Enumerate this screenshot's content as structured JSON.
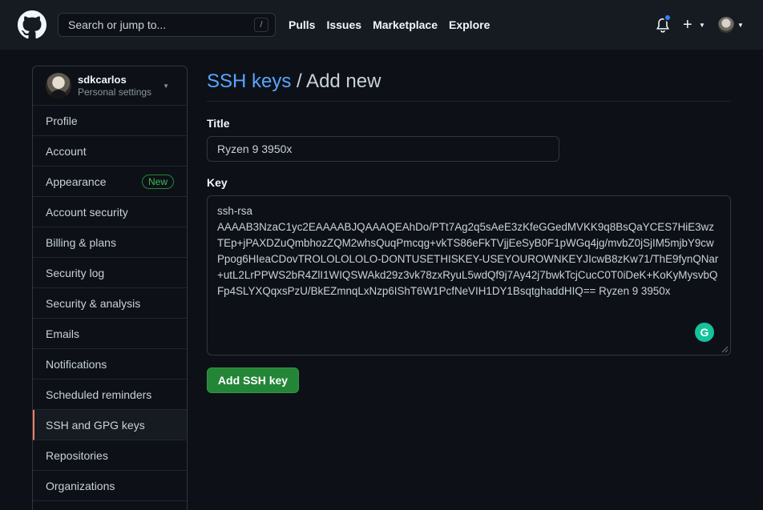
{
  "header": {
    "search_placeholder": "Search or jump to...",
    "search_shortcut": "/",
    "nav": [
      "Pulls",
      "Issues",
      "Marketplace",
      "Explore"
    ],
    "plus_symbol": "+"
  },
  "sidebar": {
    "username": "sdkcarlos",
    "subtitle": "Personal settings",
    "items": [
      {
        "label": "Profile"
      },
      {
        "label": "Account"
      },
      {
        "label": "Appearance",
        "badge": "New"
      },
      {
        "label": "Account security"
      },
      {
        "label": "Billing & plans"
      },
      {
        "label": "Security log"
      },
      {
        "label": "Security & analysis"
      },
      {
        "label": "Emails"
      },
      {
        "label": "Notifications"
      },
      {
        "label": "Scheduled reminders"
      },
      {
        "label": "SSH and GPG keys",
        "active": true
      },
      {
        "label": "Repositories"
      },
      {
        "label": "Organizations"
      }
    ]
  },
  "main": {
    "breadcrumb_link": "SSH keys",
    "breadcrumb_rest": " / Add new",
    "title_label": "Title",
    "title_value": "Ryzen 9 3950x",
    "key_label": "Key",
    "key_value": "ssh-rsa\nAAAAB3NzaC1yc2EAAAABJQAAAQEAhDo/PTt7Ag2q5sAeE3zKfeGGedMVKK9q8BsQaYCES7HiE3wzTEp+jPAXDZuQmbhozZQM2whsQuqPmcqg+vkTS86eFkTVjjEeSyB0F1pWGq4jg/mvbZ0jSjIM5mjbY9cwPpog6HIeaCDovTROLOLOLOLO-DONTUSETHISKEY-USEYOUROWNKEYJIcwB8zKw71/ThE9fynQNar+utL2LrPPWS2bR4ZlI1WIQSWAkd29z3vk78zxRyuL5wdQf9j7Ay42j7bwkTcjCucC0T0iDeK+KoKyMysvbQFp4SLYXQqxsPzU/BkEZmnqLxNzp6IShT6W1PcfNeVIH1DY1BsqtghaddHIQ== Ryzen 9 3950x",
    "grammarly_letter": "G",
    "add_button": "Add SSH key"
  },
  "colors": {
    "background": "#0d1117",
    "header": "#161b22",
    "link": "#58a6ff",
    "button_green": "#238636",
    "active_marker": "#f78166",
    "notification_dot": "#2f81f7"
  }
}
